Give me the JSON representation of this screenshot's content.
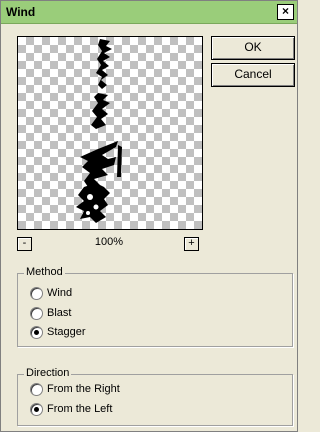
{
  "window": {
    "title": "Wind",
    "close_label": "×"
  },
  "buttons": {
    "ok_label": "OK",
    "cancel_label": "Cancel"
  },
  "zoom": {
    "out_label": "-",
    "in_label": "+",
    "level": "100%"
  },
  "method": {
    "label": "Method",
    "options": [
      {
        "label": "Wind",
        "checked": false
      },
      {
        "label": "Blast",
        "checked": false
      },
      {
        "label": "Stagger",
        "checked": true
      }
    ]
  },
  "direction": {
    "label": "Direction",
    "options": [
      {
        "label": "From the Right",
        "checked": false
      },
      {
        "label": "From the Left",
        "checked": true
      }
    ]
  }
}
